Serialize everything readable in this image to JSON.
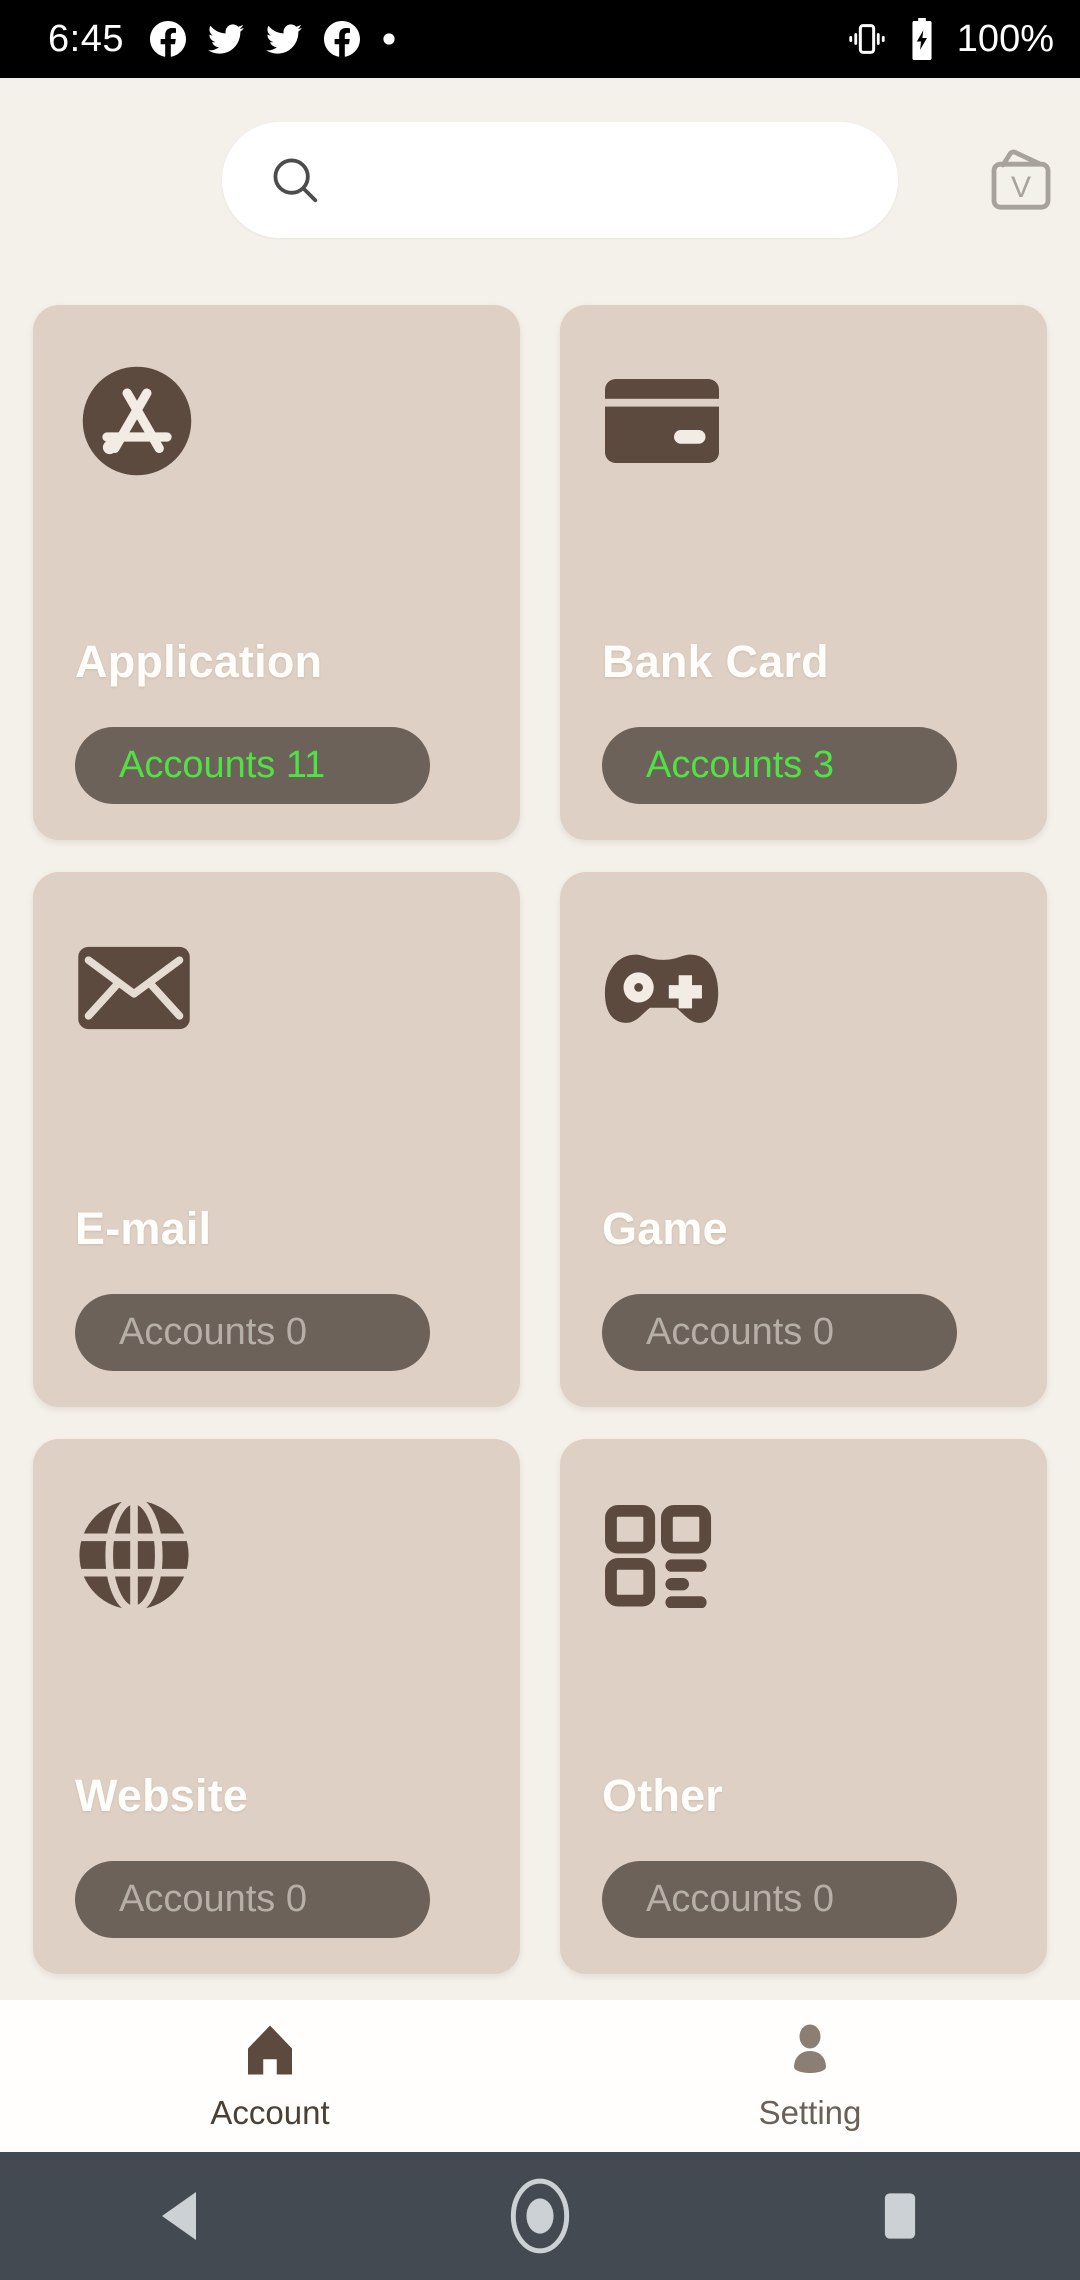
{
  "status_bar": {
    "time": "6:45",
    "notification_icons": [
      "facebook-icon",
      "twitter-icon",
      "twitter-icon",
      "facebook-icon",
      "dot-icon"
    ],
    "vibrate_icon": "vibrate-icon",
    "battery_icon": "battery-charging-icon",
    "battery_percent": "100%"
  },
  "search": {
    "value": "",
    "placeholder": "",
    "icon": "search-icon"
  },
  "vault_button": {
    "icon": "vault-folder-v-icon",
    "letter": "V"
  },
  "categories": [
    {
      "title": "Application",
      "badge": "Accounts 11",
      "count": 11,
      "icon": "app-store-icon"
    },
    {
      "title": "Bank Card",
      "badge": "Accounts 3",
      "count": 3,
      "icon": "credit-card-icon"
    },
    {
      "title": "E-mail",
      "badge": "Accounts 0",
      "count": 0,
      "icon": "envelope-icon"
    },
    {
      "title": "Game",
      "badge": "Accounts 0",
      "count": 0,
      "icon": "gamepad-icon"
    },
    {
      "title": "Website",
      "badge": "Accounts 0",
      "count": 0,
      "icon": "globe-icon"
    },
    {
      "title": "Other",
      "badge": "Accounts 0",
      "count": 0,
      "icon": "qr-grid-icon"
    }
  ],
  "tabs": [
    {
      "label": "Account",
      "icon": "home-icon",
      "active": true
    },
    {
      "label": "Setting",
      "icon": "person-icon",
      "active": false
    }
  ],
  "android_nav": {
    "back": "back-triangle-icon",
    "home": "home-circle-icon",
    "recents": "recents-square-icon"
  },
  "colors": {
    "page_background": "#f4f1ea",
    "card_background": "#ded0c4",
    "icon_brown": "#5b4a3d",
    "badge_background": "#6d6259",
    "count_positive": "#4fe244",
    "count_zero": "#b6afa8",
    "title_white": "#fffdfa",
    "nav_background": "#434a51"
  }
}
